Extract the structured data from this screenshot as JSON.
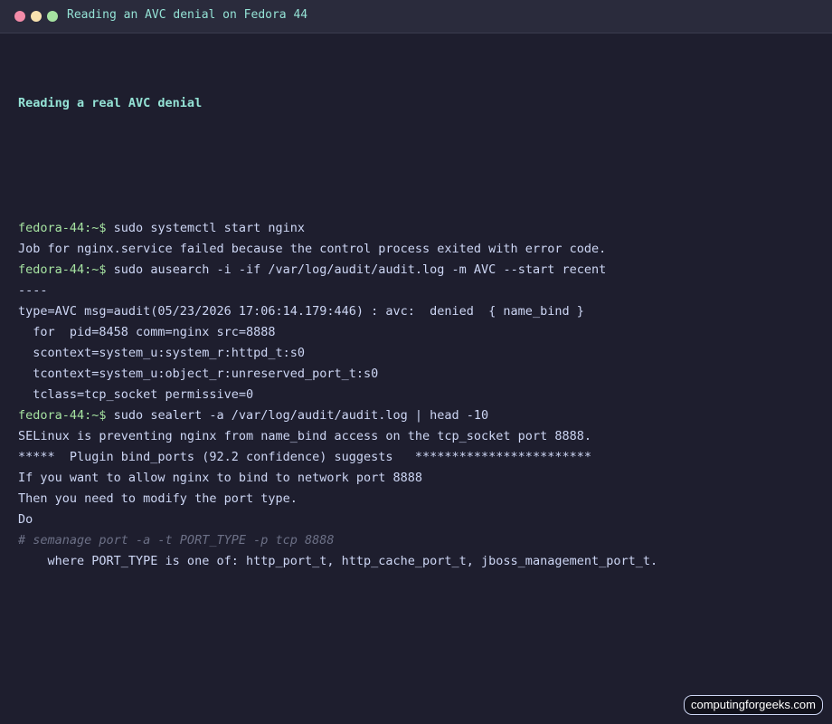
{
  "window": {
    "title": "Reading an AVC denial on Fedora 44",
    "controls": [
      {
        "name": "close",
        "color": "#f38ba8"
      },
      {
        "name": "minimize",
        "color": "#f9e2af"
      },
      {
        "name": "maximize",
        "color": "#a6e3a1"
      }
    ]
  },
  "terminal": {
    "heading": "Reading a real AVC denial",
    "lines": [
      {
        "type": "command",
        "prompt": "fedora-44:~$",
        "text": " sudo systemctl start nginx"
      },
      {
        "type": "output",
        "text": "Job for nginx.service failed because the control process exited with error code."
      },
      {
        "type": "command",
        "prompt": "fedora-44:~$",
        "text": " sudo ausearch -i -if /var/log/audit/audit.log -m AVC --start recent"
      },
      {
        "type": "output",
        "text": "----"
      },
      {
        "type": "output",
        "text": "type=AVC msg=audit(05/23/2026 17:06:14.179:446) : avc:  denied  { name_bind }"
      },
      {
        "type": "output",
        "text": "  for  pid=8458 comm=nginx src=8888"
      },
      {
        "type": "output",
        "text": "  scontext=system_u:system_r:httpd_t:s0"
      },
      {
        "type": "output",
        "text": "  tcontext=system_u:object_r:unreserved_port_t:s0"
      },
      {
        "type": "output",
        "text": "  tclass=tcp_socket permissive=0"
      },
      {
        "type": "command",
        "prompt": "fedora-44:~$",
        "text": " sudo sealert -a /var/log/audit/audit.log | head -10"
      },
      {
        "type": "output",
        "text": "SELinux is preventing nginx from name_bind access on the tcp_socket port 8888."
      },
      {
        "type": "output",
        "text": "*****  Plugin bind_ports (92.2 confidence) suggests   ************************"
      },
      {
        "type": "output",
        "text": "If you want to allow nginx to bind to network port 8888"
      },
      {
        "type": "output",
        "text": "Then you need to modify the port type."
      },
      {
        "type": "output",
        "text": "Do"
      },
      {
        "type": "comment",
        "text": "# semanage port -a -t PORT_TYPE -p tcp 8888"
      },
      {
        "type": "output",
        "text": "    where PORT_TYPE is one of: http_port_t, http_cache_port_t, jboss_management_port_t."
      }
    ]
  },
  "watermark": {
    "text": "computingforgeeks.com"
  }
}
